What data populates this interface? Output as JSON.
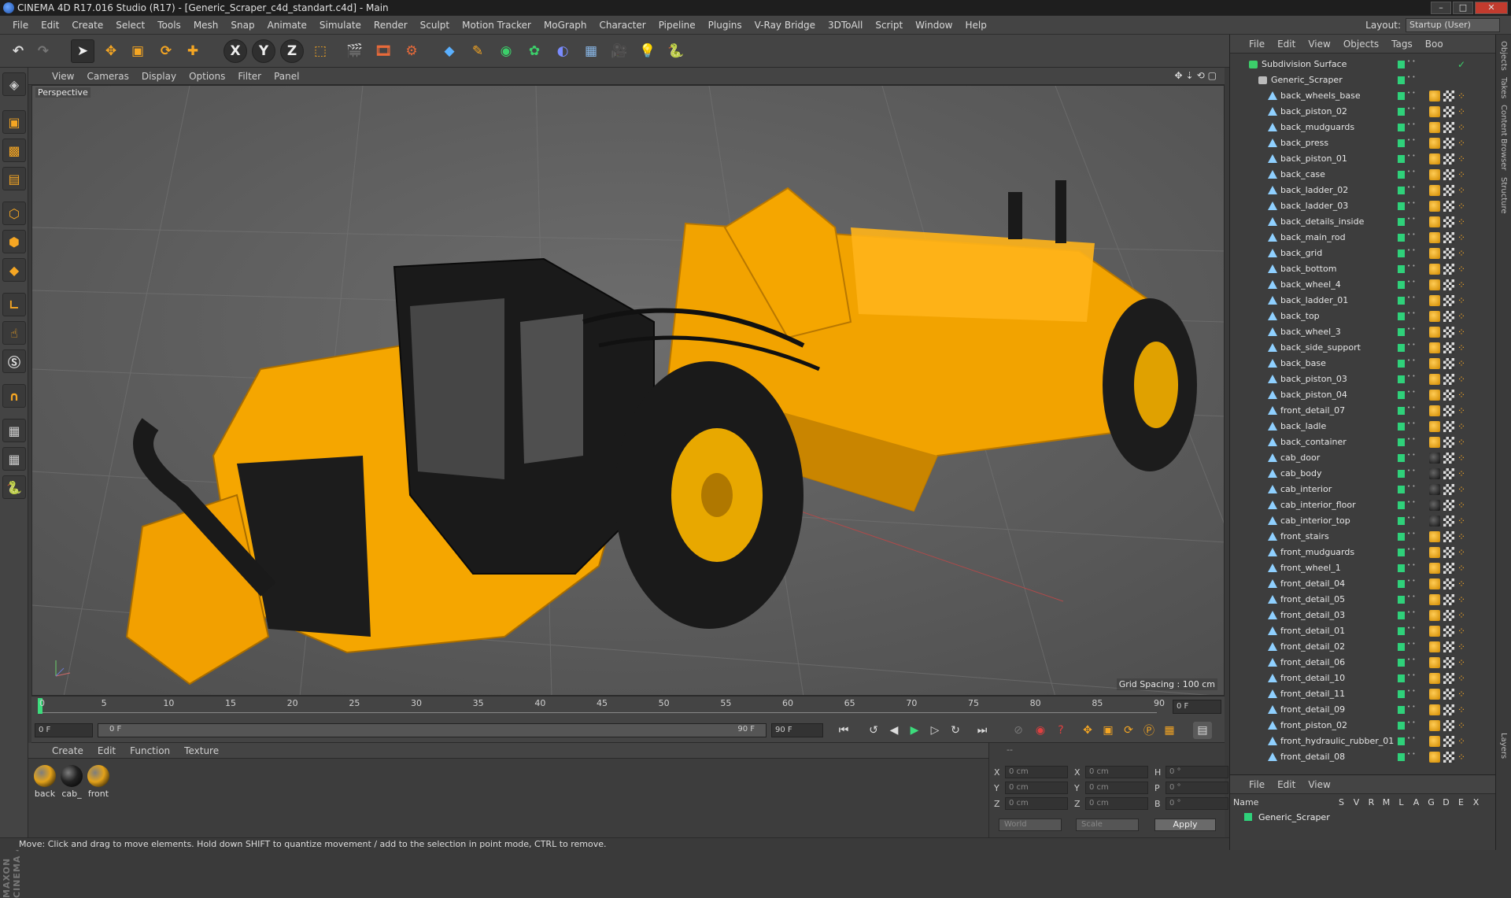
{
  "window": {
    "title": "CINEMA 4D R17.016 Studio (R17) - [Generic_Scraper_c4d_standart.c4d] - Main",
    "controls": [
      "–",
      "□",
      "✕"
    ]
  },
  "menubar": {
    "items": [
      "File",
      "Edit",
      "Create",
      "Select",
      "Tools",
      "Mesh",
      "Snap",
      "Animate",
      "Simulate",
      "Render",
      "Sculpt",
      "Motion Tracker",
      "MoGraph",
      "Character",
      "Pipeline",
      "Plugins",
      "V-Ray Bridge",
      "3DToAll",
      "Script",
      "Window",
      "Help"
    ],
    "layout_label": "Layout:",
    "layout_value": "Startup (User)"
  },
  "toolbar": {
    "axis_x": "X",
    "axis_y": "Y",
    "axis_z": "Z",
    "icons": [
      "undo-icon",
      "redo-icon",
      "select-arrow-icon",
      "move-icon",
      "scale-icon",
      "rotate-icon",
      "add-icon",
      "x-axis-icon",
      "y-axis-icon",
      "z-axis-icon",
      "coordinate-system-icon",
      "render-view-icon",
      "render-picture-viewer-icon",
      "render-settings-icon",
      "cube-icon",
      "pen-icon",
      "subdivision-icon",
      "array-icon",
      "deformer-icon",
      "floor-icon",
      "camera-icon",
      "light-icon",
      "python-icon"
    ]
  },
  "viewport": {
    "menu": [
      "View",
      "Cameras",
      "Display",
      "Options",
      "Filter",
      "Panel"
    ],
    "label": "Perspective",
    "grid_spacing": "Grid Spacing : 100 cm",
    "colors": {
      "body": "#f5a100",
      "shadow": "#c07a00",
      "cab": "#1f1f1f",
      "tire": "#202020",
      "ground": "#5f5f5f"
    }
  },
  "timeline": {
    "ticks": [
      "0",
      "5",
      "10",
      "15",
      "20",
      "25",
      "30",
      "35",
      "40",
      "45",
      "50",
      "55",
      "60",
      "65",
      "70",
      "75",
      "80",
      "85",
      "90"
    ],
    "current_frame": "0 F",
    "start_field": "0 F",
    "slider_start": "0 F",
    "slider_end": "90 F",
    "end_field": "90 F"
  },
  "materials": {
    "menu": [
      "Create",
      "Edit",
      "Function",
      "Texture"
    ],
    "items": [
      {
        "label": "back",
        "color": "#e3a21a"
      },
      {
        "label": "cab_",
        "color": "#222222"
      },
      {
        "label": "front",
        "color": "#e3a21a"
      }
    ]
  },
  "coords": {
    "header": "--",
    "rows": [
      {
        "a": "X",
        "av": "0 cm",
        "b": "X",
        "bv": "0 cm",
        "c": "H",
        "cv": "0 °"
      },
      {
        "a": "Y",
        "av": "0 cm",
        "b": "Y",
        "bv": "0 cm",
        "c": "P",
        "cv": "0 °"
      },
      {
        "a": "Z",
        "av": "0 cm",
        "b": "Z",
        "bv": "0 cm",
        "c": "B",
        "cv": "0 °"
      }
    ],
    "space": "World",
    "mode": "Scale",
    "apply": "Apply"
  },
  "status": "Move: Click and drag to move elements. Hold down SHIFT to quantize movement / add to the selection in point mode, CTRL to remove.",
  "objects": {
    "menu": [
      "File",
      "Edit",
      "View",
      "Objects",
      "Tags",
      "Boo"
    ],
    "root": "Subdivision Surface",
    "group": "Generic_Scraper",
    "items": [
      {
        "name": "back_wheels_base",
        "mat": "y"
      },
      {
        "name": "back_piston_02",
        "mat": "y"
      },
      {
        "name": "back_mudguards",
        "mat": "y"
      },
      {
        "name": "back_press",
        "mat": "y"
      },
      {
        "name": "back_piston_01",
        "mat": "y"
      },
      {
        "name": "back_case",
        "mat": "y"
      },
      {
        "name": "back_ladder_02",
        "mat": "y"
      },
      {
        "name": "back_ladder_03",
        "mat": "y"
      },
      {
        "name": "back_details_inside",
        "mat": "y"
      },
      {
        "name": "back_main_rod",
        "mat": "y"
      },
      {
        "name": "back_grid",
        "mat": "y"
      },
      {
        "name": "back_bottom",
        "mat": "y"
      },
      {
        "name": "back_wheel_4",
        "mat": "y"
      },
      {
        "name": "back_ladder_01",
        "mat": "y"
      },
      {
        "name": "back_top",
        "mat": "y"
      },
      {
        "name": "back_wheel_3",
        "mat": "y"
      },
      {
        "name": "back_side_support",
        "mat": "y"
      },
      {
        "name": "back_base",
        "mat": "y"
      },
      {
        "name": "back_piston_03",
        "mat": "y"
      },
      {
        "name": "back_piston_04",
        "mat": "y"
      },
      {
        "name": "front_detail_07",
        "mat": "y"
      },
      {
        "name": "back_ladle",
        "mat": "y"
      },
      {
        "name": "back_container",
        "mat": "y"
      },
      {
        "name": "cab_door",
        "mat": "d"
      },
      {
        "name": "cab_body",
        "mat": "d"
      },
      {
        "name": "cab_interior",
        "mat": "d"
      },
      {
        "name": "cab_interior_floor",
        "mat": "d"
      },
      {
        "name": "cab_interior_top",
        "mat": "d"
      },
      {
        "name": "front_stairs",
        "mat": "y"
      },
      {
        "name": "front_mudguards",
        "mat": "y"
      },
      {
        "name": "front_wheel_1",
        "mat": "y"
      },
      {
        "name": "front_detail_04",
        "mat": "y"
      },
      {
        "name": "front_detail_05",
        "mat": "y"
      },
      {
        "name": "front_detail_03",
        "mat": "y"
      },
      {
        "name": "front_detail_01",
        "mat": "y"
      },
      {
        "name": "front_detail_02",
        "mat": "y"
      },
      {
        "name": "front_detail_06",
        "mat": "y"
      },
      {
        "name": "front_detail_10",
        "mat": "y"
      },
      {
        "name": "front_detail_11",
        "mat": "y"
      },
      {
        "name": "front_detail_09",
        "mat": "y"
      },
      {
        "name": "front_piston_02",
        "mat": "y"
      },
      {
        "name": "front_hydraulic_rubber_01",
        "mat": "y"
      },
      {
        "name": "front_detail_08",
        "mat": "y"
      }
    ]
  },
  "layers": {
    "menu": [
      "File",
      "Edit",
      "View"
    ],
    "col_name": "Name",
    "cols": [
      "S",
      "V",
      "R",
      "M",
      "L",
      "A",
      "G",
      "D",
      "E",
      "X"
    ],
    "row": "Generic_Scraper"
  },
  "sidetabs": [
    "Objects",
    "Takes",
    "Content Browser",
    "Structure",
    "Layers"
  ]
}
